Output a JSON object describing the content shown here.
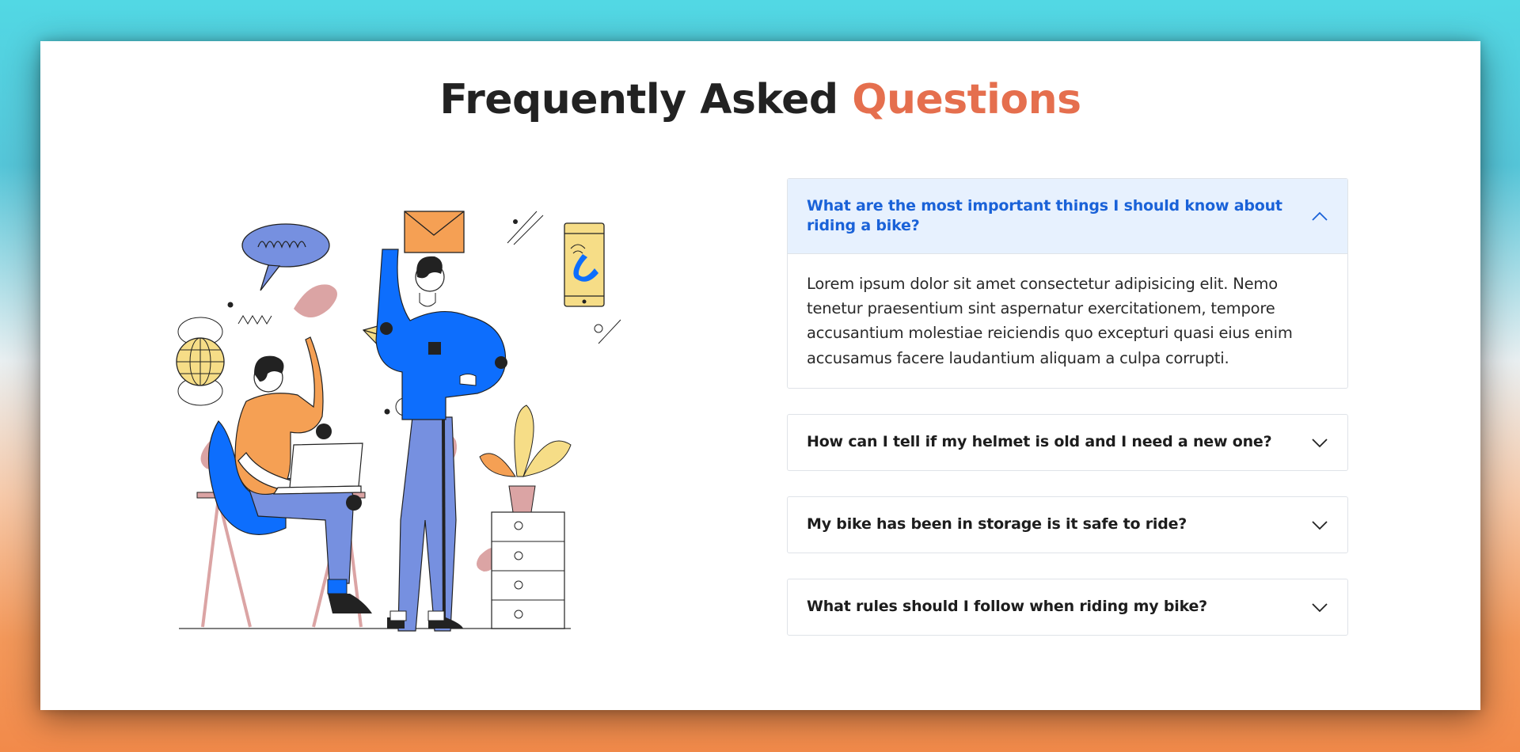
{
  "page": {
    "title_main": "Frequently Asked",
    "title_accent": "Questions"
  },
  "faq": {
    "items": [
      {
        "question": "What are the most important things I should know about riding a bike?",
        "answer": "Lorem ipsum dolor sit amet consectetur adipisicing elit. Nemo tenetur praesentium sint aspernatur exercitationem, tempore accusantium molestiae reiciendis quo excepturi quasi eius enim accusamus facere laudantium aliquam a culpa corrupti.",
        "expanded": true,
        "icon": "chevron-up-icon"
      },
      {
        "question": "How can I tell if my helmet is old and I need a new one?",
        "expanded": false,
        "icon": "chevron-down-icon"
      },
      {
        "question": "My bike has been in storage is it safe to ride?",
        "expanded": false,
        "icon": "chevron-down-icon"
      },
      {
        "question": "What rules should I follow when riding my bike?",
        "expanded": false,
        "icon": "chevron-down-icon"
      }
    ]
  },
  "colors": {
    "accent": "#e56f4e",
    "active_question": "#1a62d8",
    "active_bg": "#e7f1fe",
    "illustration_blue": "#0d6efd",
    "illustration_orange": "#f5a054",
    "illustration_pink": "#dba4a4",
    "illustration_yellow": "#f6dd87"
  }
}
